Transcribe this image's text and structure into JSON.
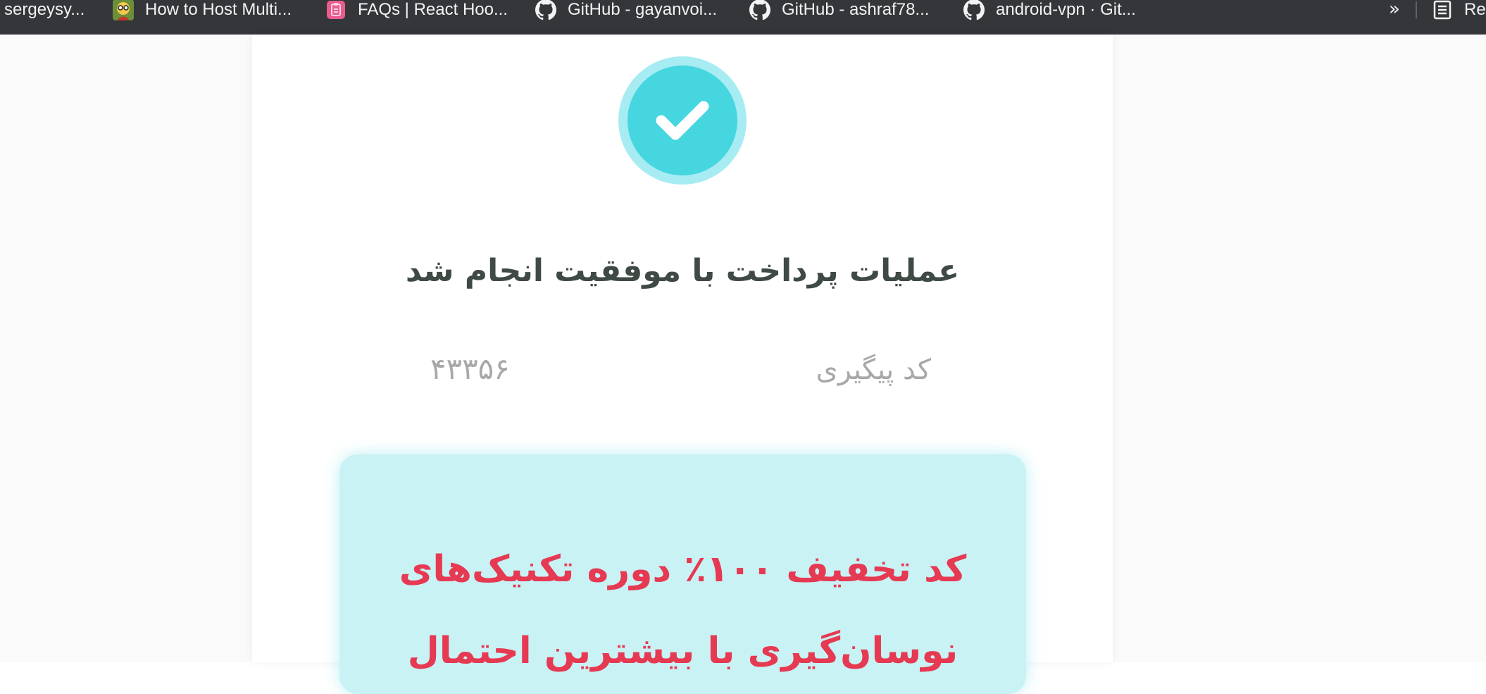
{
  "bookmarks": [
    {
      "label": "sergeysy...",
      "icon": "none"
    },
    {
      "label": "How to Host Multi...",
      "icon": "avatar-icon"
    },
    {
      "label": "FAQs | React Hoo...",
      "icon": "clipboard-icon"
    },
    {
      "label": "GitHub - gayanvoi...",
      "icon": "github-icon"
    },
    {
      "label": "GitHub - ashraf78...",
      "icon": "github-icon"
    },
    {
      "label": "android-vpn · Git...",
      "icon": "github-icon"
    }
  ],
  "overflow_label": "»",
  "reading_list_label": "Re",
  "success": {
    "title": "عملیات پرداخت با موفقیت انجام شد",
    "tracking_label": "کد پیگیری",
    "tracking_code": "۴۳۳۵۶"
  },
  "discount": {
    "line1": "کد تخفیف ۱۰۰٪ دوره تکنیک‌های",
    "line2": "نوسان‌گیری با بیشترین احتمال"
  },
  "colors": {
    "check_outer": "#a6ecf2",
    "check_inner": "#45d6e0",
    "discount_bg": "#c9f2f5",
    "discount_text": "#e63952",
    "title_text": "#3f4a45",
    "muted_text": "#a8a8a8"
  }
}
